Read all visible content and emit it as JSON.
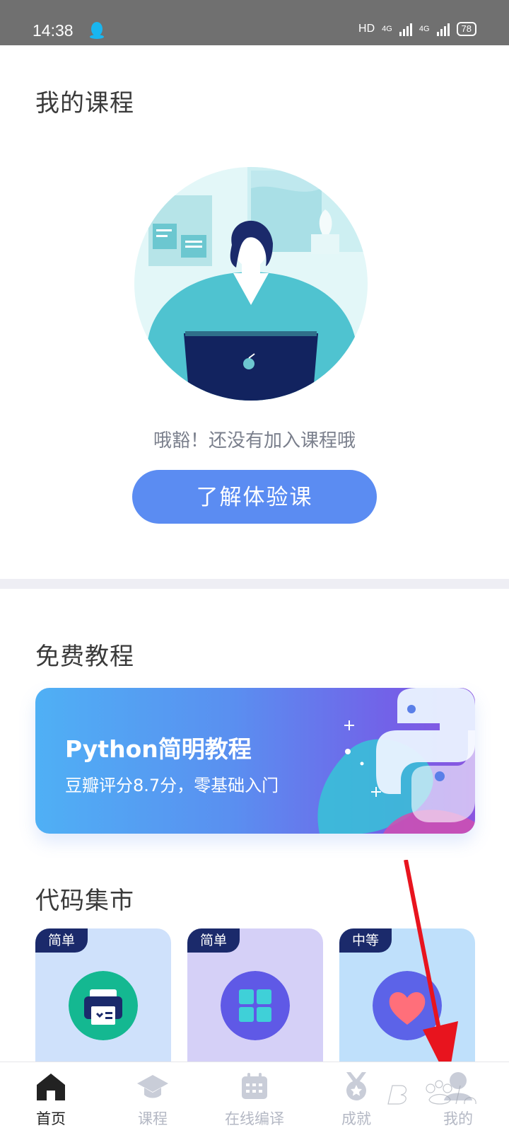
{
  "status_bar": {
    "time": "14:38",
    "network": "HD",
    "signal_1": "4G",
    "signal_2": "4G",
    "battery": "78"
  },
  "my_courses": {
    "title": "我的课程",
    "empty_message": "哦豁！还没有加入课程哦",
    "cta_label": "了解体验课"
  },
  "free_tutorials": {
    "title": "免费教程",
    "banner": {
      "title": "Python简明教程",
      "subtitle": "豆瓣评分8.7分，零基础入门"
    }
  },
  "code_market": {
    "title": "代码集市",
    "cards": [
      {
        "badge": "简单",
        "icon": "printer-icon",
        "bg": "#cfe1fb",
        "icon_bg": "#14b891"
      },
      {
        "badge": "简单",
        "icon": "grid-icon",
        "bg": "#d5d0f7",
        "icon_bg": "#5f59e6"
      },
      {
        "badge": "中等",
        "icon": "heart-icon",
        "bg": "#bfe0fb",
        "icon_bg": "#5c63e8"
      }
    ]
  },
  "bottom_nav": {
    "items": [
      {
        "label": "首页",
        "icon": "home-icon",
        "active": true
      },
      {
        "label": "课程",
        "icon": "graduation-cap-icon",
        "active": false
      },
      {
        "label": "在线编译",
        "icon": "calendar-keyboard-icon",
        "active": false
      },
      {
        "label": "成就",
        "icon": "medal-icon",
        "active": false
      },
      {
        "label": "我的",
        "icon": "user-icon",
        "active": false
      }
    ]
  },
  "colors": {
    "accent": "#5b8cf2",
    "status_bar": "#707070",
    "badge": "#1b2a6b",
    "arrow": "#e8141e"
  }
}
